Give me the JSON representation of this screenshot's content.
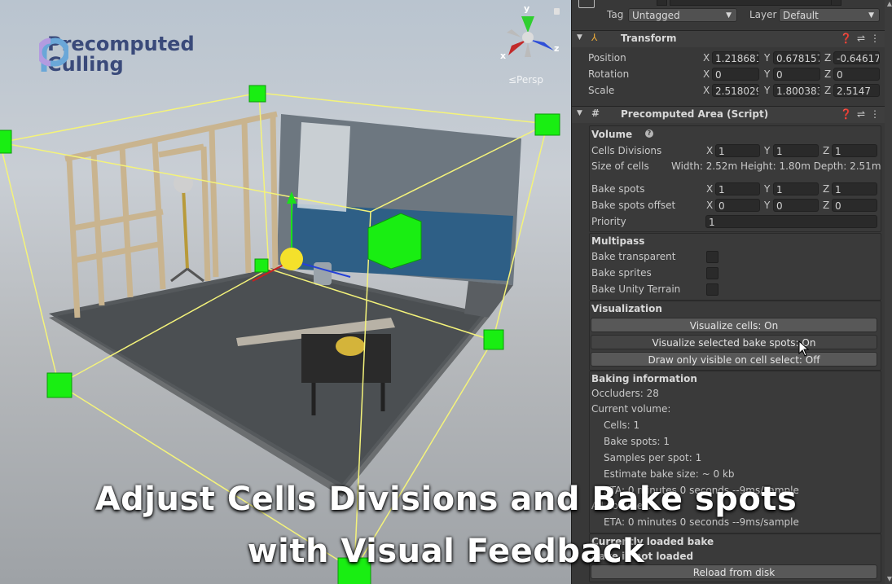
{
  "scene": {
    "logo_line1": "Precomputed",
    "logo_line2": "Culling",
    "persp_label": "≤Persp",
    "gizmo": {
      "y": "y",
      "x": "x",
      "z": "z"
    }
  },
  "caption": {
    "line1": "Adjust Cells Divisions and Bake spots",
    "line2": "with Visual Feedback"
  },
  "inspector": {
    "tag_label": "Tag",
    "tag_value": "Untagged",
    "layer_label": "Layer",
    "layer_value": "Default",
    "transform": {
      "title": "Transform",
      "position": {
        "label": "Position",
        "x": "1.218681",
        "y": "0.678157",
        "z": "-0.64617"
      },
      "rotation": {
        "label": "Rotation",
        "x": "0",
        "y": "0",
        "z": "0"
      },
      "scale": {
        "label": "Scale",
        "x": "2.518029",
        "y": "1.800383",
        "z": "2.5147"
      }
    },
    "script": {
      "title": "Precomputed Area (Script)",
      "volume": {
        "title": "Volume",
        "cells_divisions": {
          "label": "Cells Divisions",
          "x": "1",
          "y": "1",
          "z": "1"
        },
        "size_of_cells_label": "Size of cells",
        "size_of_cells_value": "Width: 2.52m Height: 1.80m Depth: 2.51m",
        "bake_spots": {
          "label": "Bake spots",
          "x": "1",
          "y": "1",
          "z": "1"
        },
        "bake_spots_offset": {
          "label": "Bake spots offset",
          "x": "0",
          "y": "0",
          "z": "0"
        },
        "priority": {
          "label": "Priority",
          "value": "1"
        }
      },
      "multipass": {
        "title": "Multipass",
        "bake_transparent": "Bake transparent",
        "bake_sprites": "Bake sprites",
        "bake_unity_terrain": "Bake Unity Terrain"
      },
      "visualization": {
        "title": "Visualization",
        "btn_cells": "Visualize cells: On",
        "btn_spots": "Visualize selected bake spots: On",
        "btn_visible": "Draw only visible on cell select: Off"
      },
      "baking": {
        "title": "Baking information",
        "occluders": "Occluders: 28",
        "current_volume": "Current volume:",
        "cells": "Cells: 1",
        "bake_spots": "Bake spots: 1",
        "samples": "Samples per spot: 1",
        "estimate": "Estimate bake size: ~ 0 kb",
        "eta1": "ETA: 0 minutes 0 seconds --9ms/sample",
        "all_label": "All volumes:",
        "eta2": "ETA: 0 minutes 0 seconds --9ms/sample"
      },
      "loaded": {
        "title": "Currently loaded bake",
        "status": "Bake is not loaded",
        "btn_reload": "Reload from disk"
      }
    }
  }
}
